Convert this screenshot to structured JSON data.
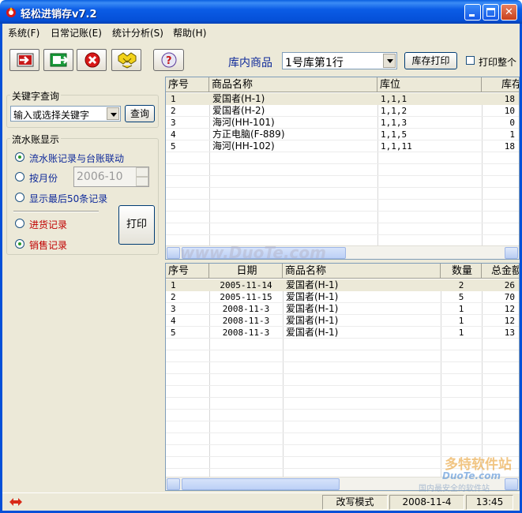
{
  "window": {
    "title": "轻松进销存v7.2"
  },
  "menu": [
    "系统(F)",
    "日常记账(E)",
    "统计分析(S)",
    "帮助(H)"
  ],
  "toolbar": {
    "stock_label": "库内商品",
    "stock_select": "1号库第1行",
    "print_stock_button": "库存打印",
    "print_all_label": "打印整个"
  },
  "search": {
    "group_title": "关键字查询",
    "input_value": "输入或选择关键字",
    "query_button": "查询"
  },
  "ledger": {
    "group_title": "流水账显示",
    "options": [
      "流水账记录与台账联动",
      "按月份",
      "显示最后50条记录"
    ],
    "month_value": "2006-10",
    "record_types": [
      "进货记录",
      "销售记录"
    ],
    "print_button": "打印"
  },
  "inventory_table": {
    "headers": [
      "序号",
      "商品名称",
      "库位",
      "库存"
    ],
    "rows": [
      [
        "1",
        "爱国者(H-1)",
        "1,1,1",
        "18"
      ],
      [
        "2",
        "爱国者(H-2)",
        "1,1,2",
        "10"
      ],
      [
        "3",
        "海河(HH-101)",
        "1,1,3",
        "0"
      ],
      [
        "4",
        "方正电脑(F-889)",
        "1,1,5",
        "1"
      ],
      [
        "5",
        "海河(HH-102)",
        "1,1,11",
        "18"
      ]
    ]
  },
  "ledger_table": {
    "headers": [
      "序号",
      "日期",
      "商品名称",
      "数量",
      "总金额"
    ],
    "rows": [
      [
        "1",
        "2005-11-14",
        "爱国者(H-1)",
        "2",
        "26"
      ],
      [
        "2",
        "2005-11-15",
        "爱国者(H-1)",
        "5",
        "70"
      ],
      [
        "3",
        "2008-11-3",
        "爱国者(H-1)",
        "1",
        "12"
      ],
      [
        "4",
        "2008-11-3",
        "爱国者(H-1)",
        "1",
        "12"
      ],
      [
        "5",
        "2008-11-3",
        "爱国者(H-1)",
        "1",
        "13"
      ]
    ]
  },
  "statusbar": {
    "mode": "改写模式",
    "date": "2008-11-4",
    "time": "13:45"
  },
  "watermarks": [
    "www.DuoTe.com",
    "多特软件站",
    "DuoTe.com",
    "国内最安全的软件站"
  ],
  "colors": {
    "title_blue": "#0550d8",
    "selection_bg": "#ece9d8",
    "sales_red": "#c00000",
    "ledger_blue": "#0f2a9a"
  },
  "icons": [
    "app-icon",
    "import-icon",
    "export-icon",
    "delete-icon",
    "stats-icon",
    "help-icon"
  ]
}
